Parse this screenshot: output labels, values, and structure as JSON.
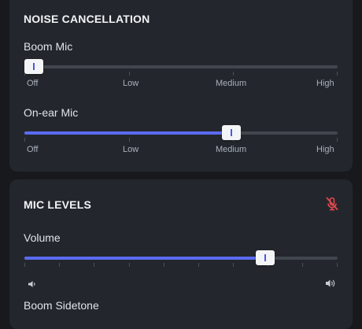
{
  "noise_cancellation": {
    "title": "NOISE CANCELLATION",
    "boom_mic": {
      "label": "Boom Mic",
      "value": 0,
      "scale": [
        "Off",
        "Low",
        "Medium",
        "High"
      ]
    },
    "on_ear_mic": {
      "label": "On-ear Mic",
      "value": 0.66,
      "scale": [
        "Off",
        "Low",
        "Medium",
        "High"
      ]
    }
  },
  "mic_levels": {
    "title": "MIC LEVELS",
    "mute_icon": "mic-muted-icon",
    "volume": {
      "label": "Volume",
      "value": 0.77,
      "min_icon": "speaker-low-icon",
      "max_icon": "speaker-high-icon"
    },
    "boom_sidetone": {
      "label": "Boom Sidetone"
    }
  },
  "colors": {
    "accent": "#5b6bf2",
    "muted_icon": "#e5484d",
    "panel": "#23272d",
    "background": "#17191d"
  }
}
